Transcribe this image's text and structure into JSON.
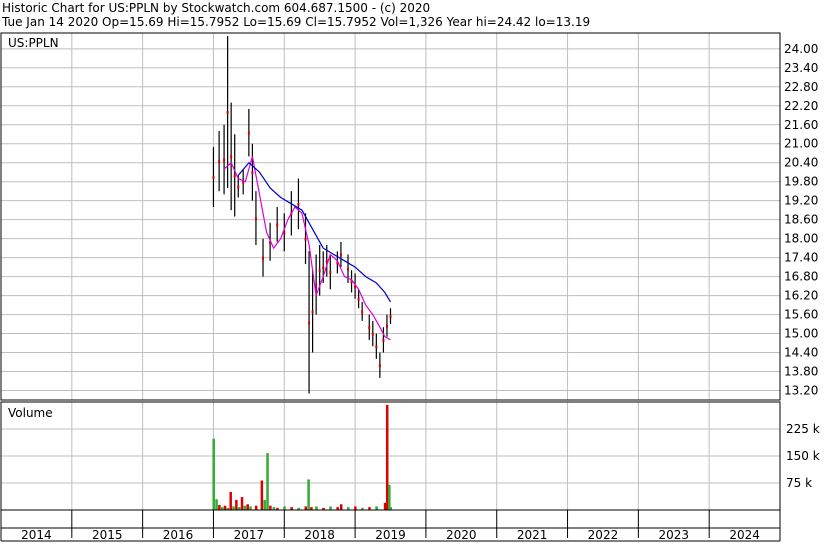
{
  "header": {
    "title_line": "Historic Chart for US:PPLN by Stockwatch.com 604.687.1500 - (c) 2020",
    "quote_line": "Tue Jan 14 2020   Op=15.69   Hi=15.7952   Lo=15.69   Cl=15.7952   Vol=1,326   Year hi=24.42   lo=13.19"
  },
  "colors": {
    "price_bar": "#000000",
    "down_day": "#cc0000",
    "up_volume": "#33aa33",
    "down_volume": "#dd0000",
    "ma_short": "#dd00dd",
    "ma_long": "#0000cc",
    "grid": "#bfbfbf"
  },
  "chart_data": {
    "type": "line",
    "price_panel": {
      "label": "US:PPLN",
      "ylim": [
        12.9,
        24.5
      ],
      "yticks": [
        "24.00",
        "23.40",
        "22.80",
        "22.20",
        "21.60",
        "21.00",
        "20.40",
        "19.80",
        "19.20",
        "18.60",
        "18.00",
        "17.40",
        "16.80",
        "16.20",
        "15.60",
        "15.00",
        "14.40",
        "13.80",
        "13.20"
      ],
      "ytick_values": [
        24.0,
        23.4,
        22.8,
        22.2,
        21.6,
        21.0,
        20.4,
        19.8,
        19.2,
        18.6,
        18.0,
        17.4,
        16.8,
        16.2,
        15.6,
        15.0,
        14.4,
        13.8,
        13.2
      ],
      "grid": true,
      "series": [
        {
          "role": "price_range",
          "x": [
            2017.0,
            2017.08,
            2017.15,
            2017.2,
            2017.25,
            2017.3,
            2017.35,
            2017.42,
            2017.5,
            2017.55,
            2017.6,
            2017.7,
            2017.8,
            2017.9,
            2018.0,
            2018.1,
            2018.2,
            2018.3,
            2018.35,
            2018.4,
            2018.45,
            2018.5,
            2018.55,
            2018.6,
            2018.65,
            2018.75,
            2018.8,
            2018.9,
            2018.95,
            2019.0,
            2019.05,
            2019.1,
            2019.2,
            2019.25,
            2019.3,
            2019.35,
            2019.4,
            2019.45,
            2019.5
          ],
          "high": [
            20.9,
            21.4,
            21.6,
            24.4,
            22.3,
            21.3,
            20.0,
            20.2,
            22.1,
            21.0,
            19.5,
            18.0,
            18.5,
            19.0,
            18.8,
            19.5,
            19.9,
            18.8,
            17.6,
            17.0,
            17.5,
            17.8,
            17.6,
            17.8,
            17.5,
            17.6,
            17.9,
            17.5,
            17.0,
            16.9,
            16.4,
            16.0,
            15.6,
            15.4,
            15.0,
            14.4,
            15.2,
            15.6,
            15.8
          ],
          "low": [
            19.0,
            19.5,
            19.4,
            19.6,
            18.9,
            18.7,
            19.3,
            19.4,
            20.6,
            19.2,
            17.8,
            16.8,
            17.3,
            17.9,
            17.6,
            18.1,
            18.3,
            17.2,
            13.1,
            14.4,
            15.6,
            16.2,
            16.6,
            16.8,
            16.4,
            16.9,
            17.1,
            16.6,
            16.3,
            16.1,
            15.8,
            15.4,
            14.8,
            14.6,
            14.2,
            13.6,
            14.4,
            14.9,
            15.3
          ]
        },
        {
          "role": "moving_average_short",
          "x": [
            2017.15,
            2017.25,
            2017.35,
            2017.45,
            2017.55,
            2017.65,
            2017.75,
            2017.85,
            2017.95,
            2018.05,
            2018.15,
            2018.25,
            2018.35,
            2018.45,
            2018.55,
            2018.65,
            2018.75,
            2018.85,
            2018.95,
            2019.05,
            2019.15,
            2019.25,
            2019.35,
            2019.42,
            2019.5
          ],
          "y": [
            20.2,
            20.4,
            19.9,
            19.8,
            20.6,
            19.4,
            18.2,
            17.7,
            18.0,
            18.6,
            19.0,
            18.8,
            17.8,
            16.2,
            16.8,
            17.5,
            17.3,
            16.8,
            16.7,
            16.4,
            15.9,
            15.6,
            15.2,
            14.9,
            14.8
          ]
        },
        {
          "role": "moving_average_long",
          "x": [
            2017.35,
            2017.5,
            2017.65,
            2017.8,
            2017.95,
            2018.1,
            2018.25,
            2018.4,
            2018.55,
            2018.7,
            2018.85,
            2019.0,
            2019.15,
            2019.3,
            2019.42,
            2019.5
          ],
          "y": [
            20.0,
            20.4,
            20.1,
            19.6,
            19.3,
            19.1,
            18.9,
            18.3,
            17.7,
            17.5,
            17.3,
            17.1,
            16.8,
            16.6,
            16.3,
            16.0
          ]
        }
      ]
    },
    "volume_panel": {
      "label": "Volume",
      "ylim": [
        0,
        300000
      ],
      "yticks": [
        "225 k",
        "150 k",
        "75 k"
      ],
      "ytick_values": [
        225000,
        150000,
        75000
      ],
      "grid": true,
      "series": [
        {
          "role": "volume",
          "x": [
            2017.0,
            2017.04,
            2017.08,
            2017.12,
            2017.16,
            2017.2,
            2017.24,
            2017.28,
            2017.32,
            2017.36,
            2017.4,
            2017.44,
            2017.48,
            2017.52,
            2017.6,
            2017.68,
            2017.72,
            2017.76,
            2017.8,
            2017.85,
            2017.9,
            2018.0,
            2018.1,
            2018.2,
            2018.3,
            2018.34,
            2018.38,
            2018.45,
            2018.55,
            2018.65,
            2018.75,
            2018.8,
            2018.9,
            2019.0,
            2019.1,
            2019.2,
            2019.3,
            2019.42,
            2019.45,
            2019.48,
            2019.5
          ],
          "values": [
            198000,
            30000,
            14000,
            8000,
            12000,
            6000,
            50000,
            10000,
            28000,
            8000,
            36000,
            12000,
            16000,
            10000,
            12000,
            82000,
            28000,
            158000,
            12000,
            8000,
            6000,
            10000,
            8000,
            6000,
            10000,
            85000,
            8000,
            10000,
            6000,
            10000,
            8000,
            16000,
            8000,
            10000,
            6000,
            8000,
            10000,
            20000,
            292000,
            70000,
            8000
          ],
          "direction": [
            "up",
            "up",
            "down",
            "up",
            "down",
            "up",
            "down",
            "up",
            "down",
            "up",
            "down",
            "up",
            "down",
            "up",
            "down",
            "down",
            "up",
            "up",
            "down",
            "up",
            "down",
            "up",
            "down",
            "up",
            "down",
            "up",
            "down",
            "up",
            "down",
            "up",
            "down",
            "down",
            "up",
            "down",
            "up",
            "down",
            "up",
            "down",
            "down",
            "up",
            "up"
          ]
        }
      ]
    },
    "x_axis": {
      "xlim": [
        2014.0,
        2025.0
      ],
      "labels": [
        "2014",
        "2015",
        "2016",
        "2017",
        "2018",
        "2019",
        "2020",
        "2021",
        "2022",
        "2023",
        "2024"
      ],
      "label_values": [
        2014,
        2015,
        2016,
        2017,
        2018,
        2019,
        2020,
        2021,
        2022,
        2023,
        2024
      ]
    }
  }
}
